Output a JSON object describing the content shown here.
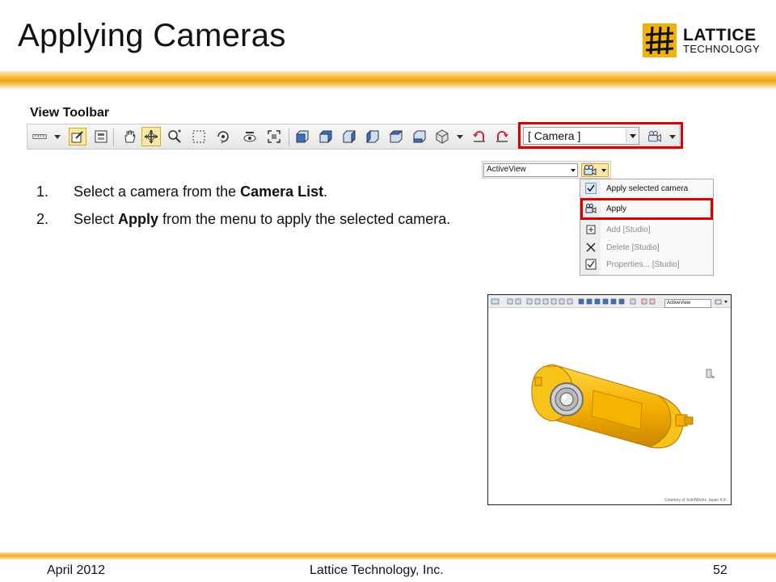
{
  "slide": {
    "title": "Applying Cameras",
    "logo": {
      "line1": "LATTICE",
      "line2": "TECHNOLOGY"
    },
    "section_label": "View Toolbar"
  },
  "toolbar": {
    "camera_list_value": "[ Camera ]",
    "icons": [
      "ruler-icon",
      "select-icon",
      "properties-icon",
      "pan-icon",
      "rotate-icon",
      "zoom-icon",
      "zoom-box-icon",
      "orbit-icon",
      "walk-icon",
      "fit-icon",
      "view-front-icon",
      "view-back-icon",
      "view-left-icon",
      "view-right-icon",
      "view-top-icon",
      "view-bottom-icon",
      "view-iso-icon",
      "undo-view-icon",
      "redo-view-icon",
      "camera-icon"
    ]
  },
  "steps": [
    {
      "num": "1.",
      "before": "Select a camera from the ",
      "bold": "Camera List",
      "after": "."
    },
    {
      "num": "2.",
      "before": "Select ",
      "bold": "Apply",
      "after": " from the menu to apply the selected camera."
    }
  ],
  "camera_menu": {
    "list_value": "ActiveView",
    "items": [
      {
        "label": "Apply selected camera",
        "icon": "check-icon",
        "enabled": true
      },
      {
        "label": "Apply",
        "icon": "camera-icon",
        "enabled": true
      },
      {
        "label": "Add [Studio]",
        "icon": "add-icon",
        "enabled": false
      },
      {
        "label": "Delete [Studio]",
        "icon": "delete-icon",
        "enabled": false
      },
      {
        "label": "Properties... [Studio]",
        "icon": "properties-icon",
        "enabled": false
      }
    ]
  },
  "viewer": {
    "list_value": "ActiveView",
    "credit": "Courtesy of SolidWorks Japan K.K."
  },
  "footer": {
    "date": "April 2012",
    "company": "Lattice Technology, Inc.",
    "page": "52"
  },
  "colors": {
    "accent_band": "#f0a010",
    "highlight_red": "#d90000",
    "model_yellow": "#f5b800"
  }
}
